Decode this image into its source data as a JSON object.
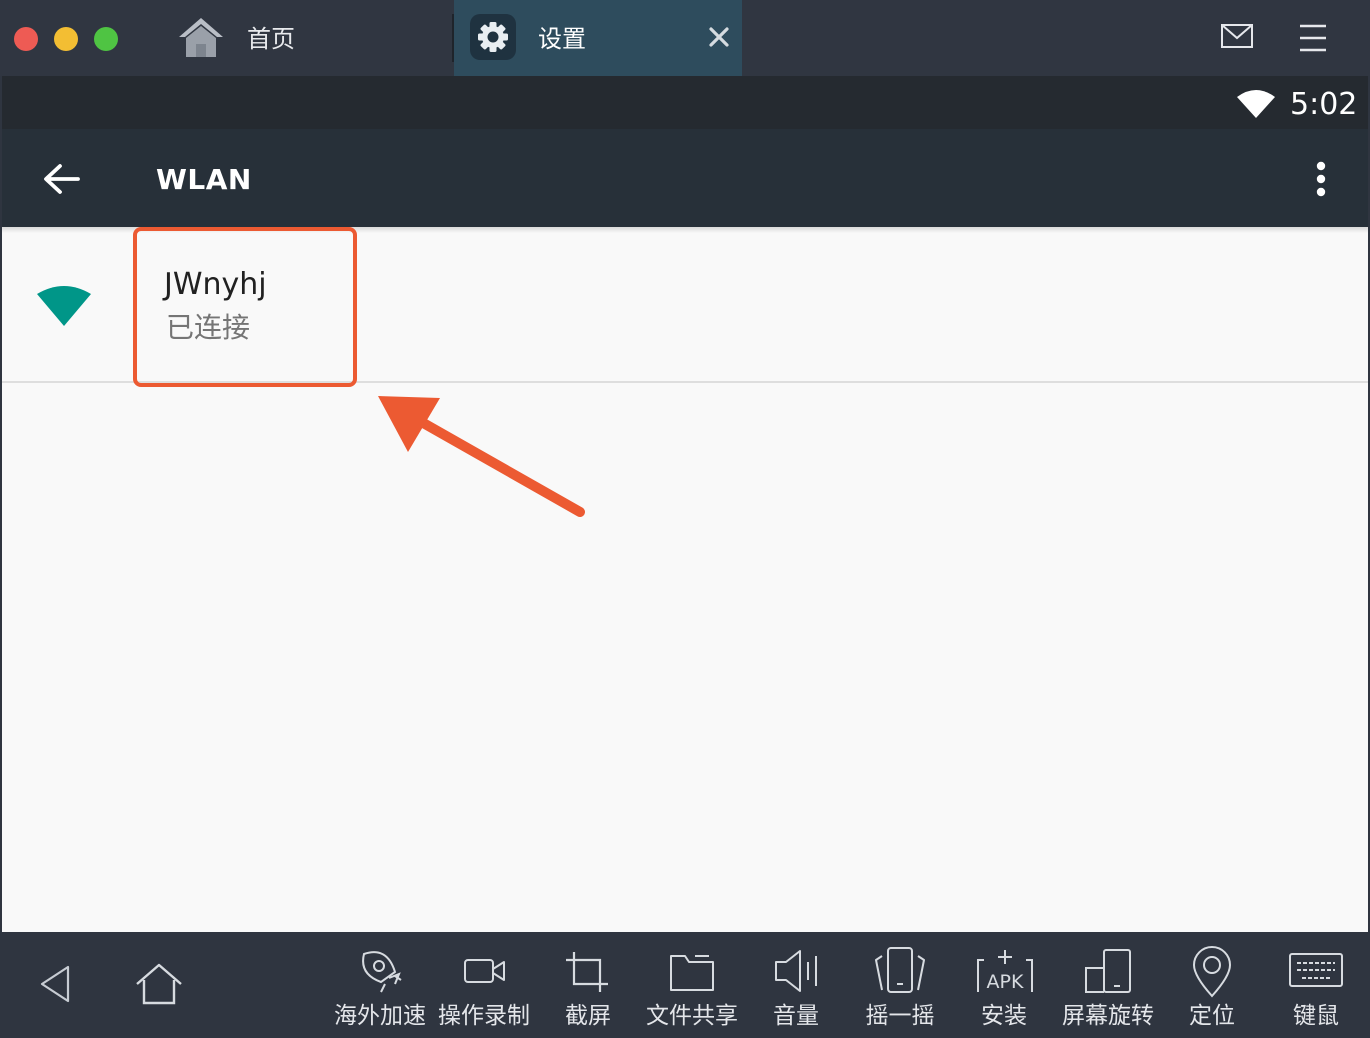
{
  "window": {
    "tabs": [
      {
        "label": "首页",
        "icon": "home-icon",
        "active": false
      },
      {
        "label": "设置",
        "icon": "gear-icon",
        "active": true
      }
    ],
    "close_glyph": "✕",
    "traffic_lights": {
      "red": "#ee5b54",
      "yellow": "#f3be33",
      "green": "#4fc443"
    }
  },
  "status_bar": {
    "time": "5:02",
    "wifi_icon": "wifi-full-icon"
  },
  "action_bar": {
    "title": "WLAN",
    "back_icon": "arrow-left-icon",
    "overflow_icon": "more-vert-icon"
  },
  "wifi": {
    "ssid": "JWnyhj",
    "status": "已连接",
    "signal_icon": "wifi-signal-icon",
    "accent_color": "#009688"
  },
  "annotation": {
    "color": "#ec5a32",
    "shape": "highlight-box-with-arrow"
  },
  "toolbar": {
    "nav": [
      {
        "name": "back",
        "icon": "triangle-back-icon"
      },
      {
        "name": "home",
        "icon": "home-outline-icon"
      }
    ],
    "tools": [
      {
        "label": "海外加速",
        "icon": "rocket-icon"
      },
      {
        "label": "操作录制",
        "icon": "video-camera-icon"
      },
      {
        "label": "截屏",
        "icon": "crop-icon"
      },
      {
        "label": "文件共享",
        "icon": "folder-icon"
      },
      {
        "label": "音量",
        "icon": "speaker-icon"
      },
      {
        "label": "摇一摇",
        "icon": "shake-phone-icon"
      },
      {
        "label": "安装",
        "icon": "apk-install-icon",
        "icon_text": "APK"
      },
      {
        "label": "屏幕旋转",
        "icon": "rotate-screen-icon"
      },
      {
        "label": "定位",
        "icon": "location-pin-icon"
      },
      {
        "label": "键鼠",
        "icon": "keyboard-icon"
      }
    ]
  }
}
